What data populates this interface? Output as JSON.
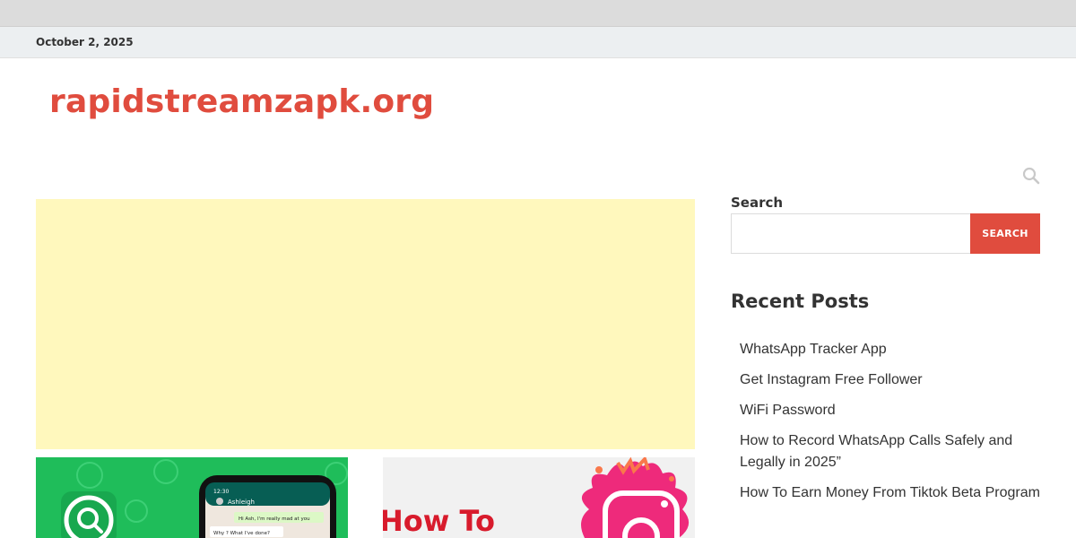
{
  "date_bar": {
    "date": "October 2, 2025"
  },
  "header": {
    "site_title": "rapidstreamzapk.org"
  },
  "colors": {
    "accent": "#e04c3e",
    "ad_background": "#fff8bd",
    "top_bar": "#dcdcdc",
    "date_bar": "#eceff1"
  },
  "icons": {
    "header_search": "search-icon"
  },
  "sidebar": {
    "search": {
      "label": "Search",
      "placeholder": "",
      "value": "",
      "button_label": "SEARCH"
    },
    "recent_posts": {
      "title": "Recent Posts",
      "items": [
        "WhatsApp Tracker App",
        "Get Instagram Free Follower",
        "WiFi Password",
        "How to Record WhatsApp Calls Safely and Legally in 2025”",
        "How To Earn Money From Tiktok Beta Program"
      ]
    }
  },
  "thumbnails": {
    "phone_time": "12:30",
    "phone_contact": "Ashleigh",
    "chat_message_1": "Hi Ash, I'm really mad at you",
    "chat_message_2": "Why ? What I've done?",
    "thumb2_text": "How To"
  }
}
